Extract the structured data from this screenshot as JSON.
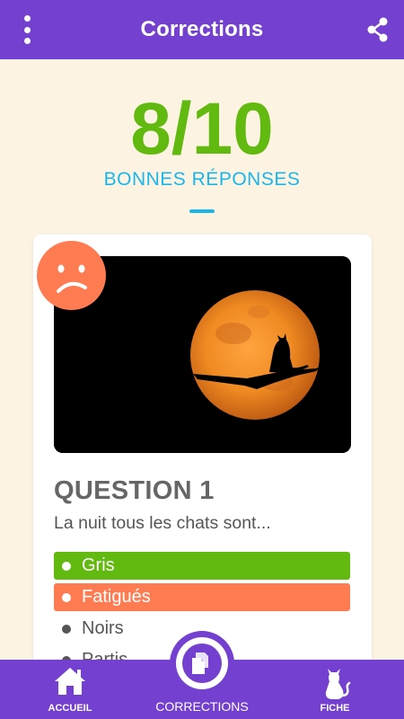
{
  "header": {
    "title": "Corrections"
  },
  "score": {
    "value": "8/10",
    "label": "BONNES RÉPONSES"
  },
  "question": {
    "title": "QUESTION 1",
    "text": "La nuit tous les chats sont..."
  },
  "answers": [
    {
      "label": "Gris",
      "state": "correct"
    },
    {
      "label": "Fatigués",
      "state": "wrong"
    },
    {
      "label": "Noirs",
      "state": "neutral"
    },
    {
      "label": "Partis",
      "state": "neutral"
    }
  ],
  "nav": {
    "home": "ACCUEIL",
    "corrections": "CORRECTIONS",
    "fiche": "FICHE"
  },
  "colors": {
    "primary": "#7440cf",
    "correct": "#62b90f",
    "wrong": "#ff7c52",
    "accent": "#1ab6ea",
    "background": "#fdf3e3"
  },
  "icons": {
    "menu": "more-vertical-icon",
    "share": "share-icon",
    "result": "sad-face-icon",
    "home": "home-icon",
    "corrections": "documents-icon",
    "fiche": "cat-icon"
  }
}
